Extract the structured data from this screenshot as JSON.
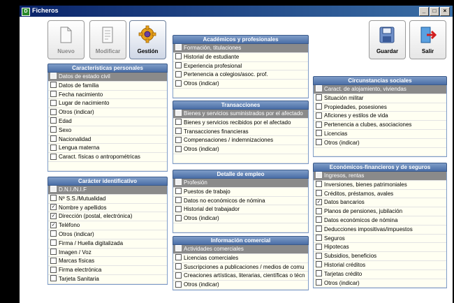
{
  "window": {
    "title": "Ficheros",
    "app_icon": "D",
    "controls": [
      "_",
      "□",
      "×"
    ]
  },
  "toolbar": {
    "nuevo": "Nuevo",
    "modificar": "Modificar",
    "gestion": "Gestión",
    "guardar": "Guardar",
    "salir": "Salir"
  },
  "panels": {
    "caracteristicas": {
      "title": "Características personales",
      "items": [
        {
          "label": "Datos de estado civil",
          "checked": false,
          "header": true
        },
        {
          "label": "Datos de familia",
          "checked": false
        },
        {
          "label": "Fecha nacimiento",
          "checked": false
        },
        {
          "label": "Lugar de nacimiento",
          "checked": false
        },
        {
          "label": "Otros (indicar)",
          "checked": false
        },
        {
          "label": "Edad",
          "checked": false
        },
        {
          "label": "Sexo",
          "checked": false
        },
        {
          "label": "Nacionalidad",
          "checked": false
        },
        {
          "label": "Lengua materna",
          "checked": false
        },
        {
          "label": "Caract. físicas o antropométricas",
          "checked": false
        },
        {
          "label": "",
          "checked": false,
          "blank": true
        }
      ]
    },
    "identificativo": {
      "title": "Carácter identificativo",
      "items": [
        {
          "label": "D.N.I./N.I.F",
          "checked": false,
          "header": true
        },
        {
          "label": "Nº S.S./Mutualidad",
          "checked": false
        },
        {
          "label": "Nombre y apellidos",
          "checked": true
        },
        {
          "label": "Dirección (postal, electrónica)",
          "checked": true
        },
        {
          "label": "Teléfono",
          "checked": true
        },
        {
          "label": "Otros (indicar)",
          "checked": false
        },
        {
          "label": "Firma / Huella digitalizada",
          "checked": false
        },
        {
          "label": "Imagen / Voz",
          "checked": false
        },
        {
          "label": "Marcas físicas",
          "checked": false
        },
        {
          "label": "Firma electrónica",
          "checked": false
        },
        {
          "label": "Tarjeta Sanitaria",
          "checked": false
        }
      ]
    },
    "academicos": {
      "title": "Académicos y profesionales",
      "items": [
        {
          "label": "Formación, titulaciones",
          "checked": false,
          "header": true
        },
        {
          "label": "Historial de estudiante",
          "checked": false
        },
        {
          "label": "Experiencia profesional",
          "checked": false
        },
        {
          "label": "Pertenencia a colegios/asoc. prof.",
          "checked": false
        },
        {
          "label": "Otros (indicar)",
          "checked": false
        },
        {
          "label": "",
          "checked": false,
          "blank": true
        }
      ]
    },
    "transacciones": {
      "title": "Transacciones",
      "items": [
        {
          "label": "Bienes y servicios suministrados por el afectado",
          "checked": false,
          "header": true
        },
        {
          "label": "Bienes y servicios recibidos por el afectado",
          "checked": false
        },
        {
          "label": "Transacciones financieras",
          "checked": false
        },
        {
          "label": "Compensaciones / indemnizaciones",
          "checked": false
        },
        {
          "label": "Otros (indicar)",
          "checked": false
        },
        {
          "label": "",
          "checked": false,
          "blank": true
        }
      ]
    },
    "empleo": {
      "title": "Detalle de empleo",
      "items": [
        {
          "label": "Profesión",
          "checked": false,
          "header": true
        },
        {
          "label": "Puestos de trabajo",
          "checked": false
        },
        {
          "label": "Datos no económicos de nómina",
          "checked": false
        },
        {
          "label": "Historial del trabajador",
          "checked": false
        },
        {
          "label": "Otros (indicar)",
          "checked": false
        },
        {
          "label": "",
          "checked": false,
          "blank": true
        }
      ]
    },
    "comercial": {
      "title": "Información comercial",
      "items": [
        {
          "label": "Actividades comerciales",
          "checked": false,
          "header": true
        },
        {
          "label": "Licencias comerciales",
          "checked": false
        },
        {
          "label": "Suscripciones a publicaciones / medios de comu",
          "checked": false
        },
        {
          "label": "Creaciones artísticas, literarias, científicas o técn",
          "checked": false
        },
        {
          "label": "Otros (indicar)",
          "checked": false
        }
      ]
    },
    "circunstancias": {
      "title": "Circunstancias sociales",
      "items": [
        {
          "label": "Caract. de alojamiento, viviendas",
          "checked": false,
          "header": true
        },
        {
          "label": "Situación militar",
          "checked": false
        },
        {
          "label": "Propiedades, posesiones",
          "checked": false
        },
        {
          "label": "Aficiones y estilos de vida",
          "checked": false
        },
        {
          "label": "Pertenencia a clubes, asociaciones",
          "checked": false
        },
        {
          "label": "Licencias",
          "checked": false
        },
        {
          "label": "Otros (indicar)",
          "checked": false
        },
        {
          "label": "",
          "checked": false,
          "blank": true
        }
      ]
    },
    "economicos": {
      "title": "Económicos-financieros y de seguros",
      "items": [
        {
          "label": "Ingresos, rentas",
          "checked": false,
          "header": true
        },
        {
          "label": "Inversiones, bienes patrimoniales",
          "checked": false
        },
        {
          "label": "Créditos, préstamos, avales",
          "checked": false
        },
        {
          "label": "Datos bancarios",
          "checked": true
        },
        {
          "label": "Planos de pensiones, jubilación",
          "checked": false
        },
        {
          "label": "Datos económicos de nómina",
          "checked": false
        },
        {
          "label": "Deducciones impositivas/impuestos",
          "checked": false
        },
        {
          "label": "Seguros",
          "checked": false
        },
        {
          "label": "Hipotecas",
          "checked": false
        },
        {
          "label": "Subsidios, beneficios",
          "checked": false
        },
        {
          "label": "Historial créditos",
          "checked": false
        },
        {
          "label": "Tarjetas crédito",
          "checked": false
        },
        {
          "label": "Otros (indicar)",
          "checked": false
        }
      ]
    }
  }
}
